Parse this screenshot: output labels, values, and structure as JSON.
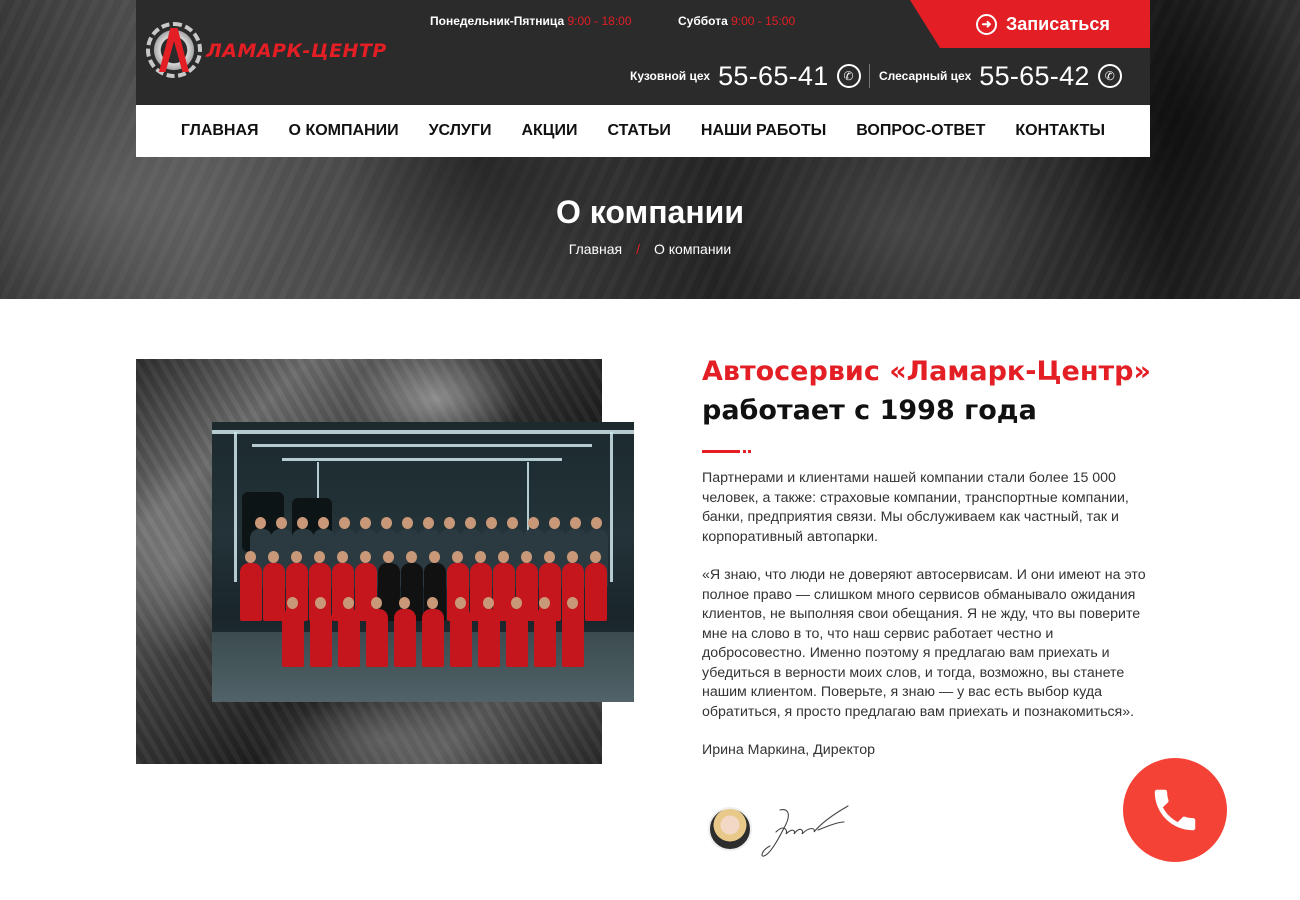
{
  "header": {
    "logo_text": "ЛАМАРК-ЦЕНТР",
    "hours": [
      {
        "label": "Понедельник-Пятница",
        "time": "9:00 - 18:00"
      },
      {
        "label": "Суббота",
        "time": "9:00 - 15:00"
      }
    ],
    "signup_label": "Записаться",
    "phones": [
      {
        "label": "Кузовной цех",
        "number": "55-65-41"
      },
      {
        "label": "Слесарный цех",
        "number": "55-65-42"
      }
    ]
  },
  "nav": {
    "items": [
      "ГЛАВНАЯ",
      "О КОМПАНИИ",
      "УСЛУГИ",
      "АКЦИИ",
      "СТАТЬИ",
      "НАШИ РАБОТЫ",
      "ВОПРОС-ОТВЕТ",
      "КОНТАКТЫ"
    ]
  },
  "hero": {
    "title": "О компании",
    "breadcrumb": {
      "home": "Главная",
      "separator": "/",
      "current": "О компании"
    }
  },
  "about": {
    "title_red": "Автосервис «Ламарк-Центр»",
    "title_black": "работает с 1998 года",
    "paragraph_1": "Партнерами и клиентами нашей компании стали более 15 000 человек, а также: страховые компании, транспортные компании, банки, предприятия связи. Мы обслуживаем как частный, так и корпоративный автопарки.",
    "paragraph_2": "«Я знаю, что люди не доверяют автосервисам. И они имеют на это полное право — слишком много сервисов обманывало ожидания клиентов, не выполняя свои обещания. Я не жду, что вы поверите мне на слово в то, что наш сервис работает честно и добросовестно. Именно поэтому я предлагаю вам приехать и убедиться в верности моих слов, и тогда, возможно, вы станете нашим клиентом. Поверьте, я знаю — у вас есть выбор куда обратиться, я просто предлагаю вам приехать и познакомиться».",
    "author": "Ирина Маркина, Директор"
  },
  "colors": {
    "accent": "#e31e24",
    "header_bg": "#2b2b2b",
    "call_button": "#f44336"
  },
  "icons": [
    "arrow-right-circle-icon",
    "whatsapp-icon",
    "phone-icon"
  ]
}
